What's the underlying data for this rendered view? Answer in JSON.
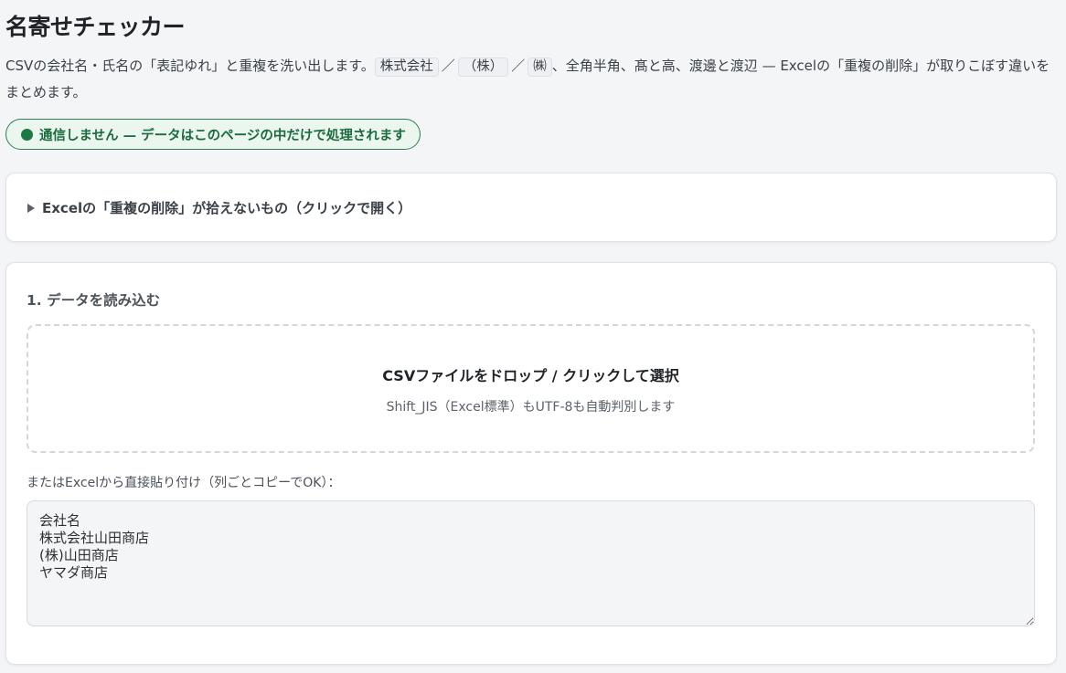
{
  "header": {
    "title": "名寄せチェッカー"
  },
  "lead": {
    "prefix": "CSVの会社名・氏名の「表記ゆれ」と重複を洗い出します。",
    "code1": "株式会社",
    "sep1": "／",
    "code2": "（株）",
    "sep2": "／",
    "code3": "㈱",
    "suffix": "、全角半角、髙と高、渡邊と渡辺 — Excelの「重複の削除」が取りこぼす違いをまとめます。"
  },
  "status_pill": {
    "text": "通信しません — データはこのページの中だけで処理されます",
    "color": "#1b7a44"
  },
  "details": {
    "summary": "Excelの「重複の削除」が拾えないもの（クリックで開く）",
    "expanded": false
  },
  "load_section": {
    "title": "1. データを読み込む",
    "dropzone_title": "CSVファイルをドロップ / クリックして選択",
    "dropzone_sub": "Shift_JIS（Excel標準）もUTF-8も自動判別します",
    "paste_label": "またはExcelから直接貼り付け（列ごとコピーでOK）：",
    "paste_value": "会社名\n株式会社山田商店\n(株)山田商店\nヤマダ商店"
  }
}
